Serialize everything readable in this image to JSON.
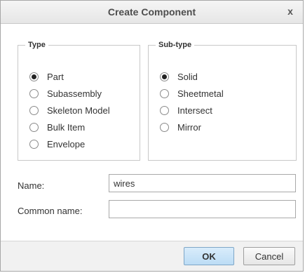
{
  "dialog": {
    "title": "Create Component",
    "close_glyph": "x"
  },
  "type_group": {
    "legend": "Type",
    "options": [
      {
        "label": "Part",
        "selected": true
      },
      {
        "label": "Subassembly",
        "selected": false
      },
      {
        "label": "Skeleton Model",
        "selected": false
      },
      {
        "label": "Bulk Item",
        "selected": false
      },
      {
        "label": "Envelope",
        "selected": false
      }
    ]
  },
  "subtype_group": {
    "legend": "Sub-type",
    "options": [
      {
        "label": "Solid",
        "selected": true
      },
      {
        "label": "Sheetmetal",
        "selected": false
      },
      {
        "label": "Intersect",
        "selected": false
      },
      {
        "label": "Mirror",
        "selected": false
      }
    ]
  },
  "fields": {
    "name_label": "Name:",
    "name_value": "wires",
    "common_name_label": "Common name:",
    "common_name_value": ""
  },
  "buttons": {
    "ok_label": "OK",
    "cancel_label": "Cancel"
  },
  "colors": {
    "ok_button": "#bcdcf5",
    "footer_bg": "#f1f1f1"
  }
}
